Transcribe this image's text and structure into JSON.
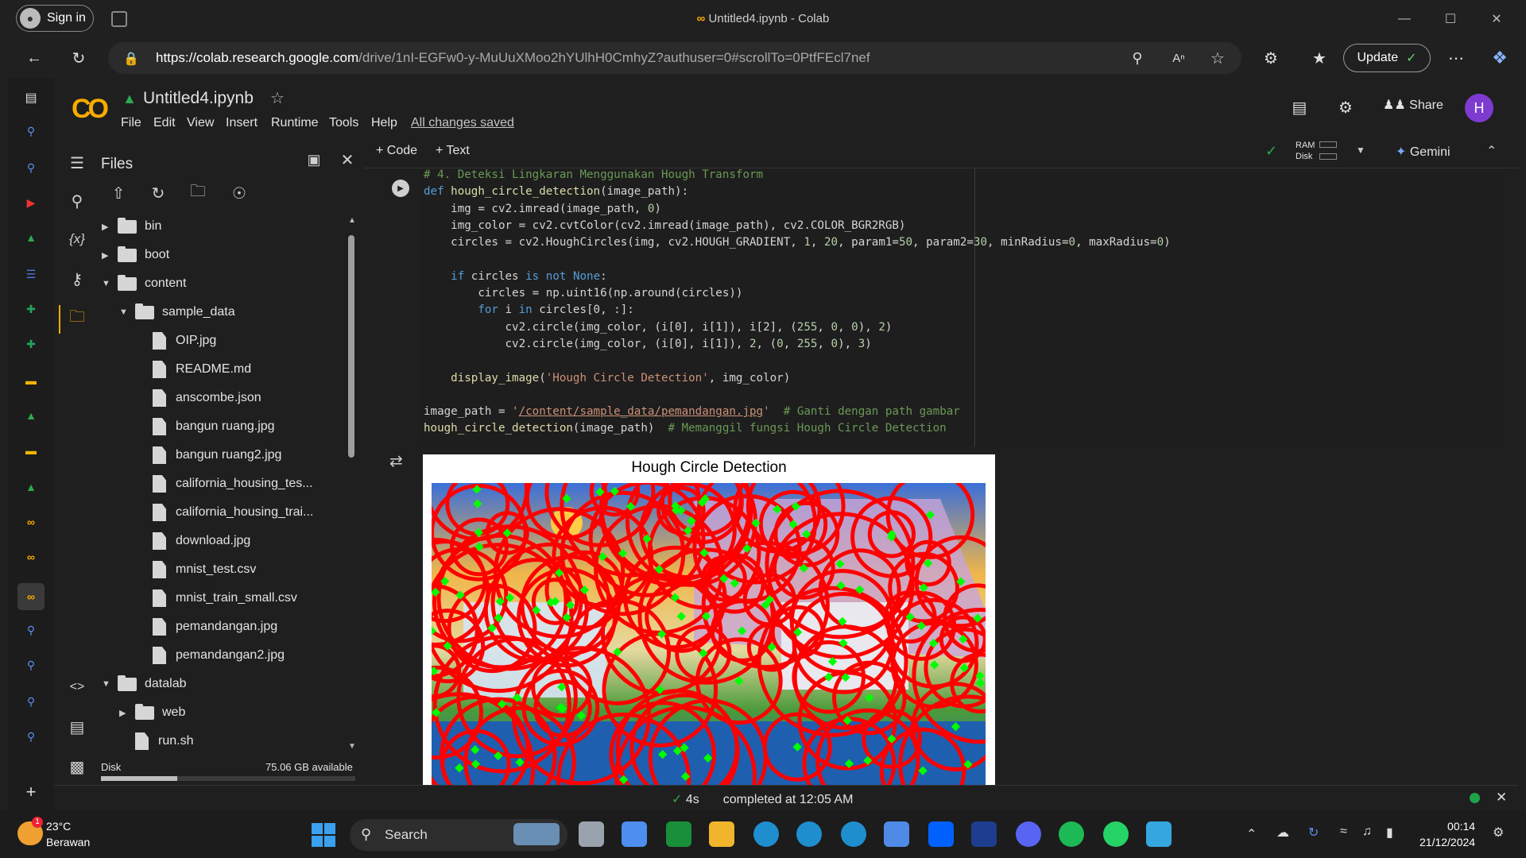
{
  "browser": {
    "sign_in": "Sign in",
    "window_title": "Untitled4.ipynb - Colab",
    "url_host": "https://colab.research.google.com",
    "url_path": "/drive/1nI-EGFw0-y-MuUuXMoo2hYUlhH0CmhyZ?authuser=0#scrollTo=0PtfFEcl7nef",
    "update_label": "Update"
  },
  "colab": {
    "notebook_name": "Untitled4.ipynb",
    "menu": [
      "File",
      "Edit",
      "View",
      "Insert",
      "Runtime",
      "Tools",
      "Help"
    ],
    "saved_status": "All changes saved",
    "share_label": "Share",
    "avatar_letter": "H",
    "add_code": "+ Code",
    "add_text": "+ Text",
    "ram_label": "RAM",
    "disk_label": "Disk",
    "gemini_label": "Gemini"
  },
  "files": {
    "title": "Files",
    "tree": [
      {
        "name": "bin",
        "type": "folder",
        "level": 0,
        "state": "collapsed"
      },
      {
        "name": "boot",
        "type": "folder",
        "level": 0,
        "state": "collapsed"
      },
      {
        "name": "content",
        "type": "folder",
        "level": 0,
        "state": "expanded"
      },
      {
        "name": "sample_data",
        "type": "folder",
        "level": 1,
        "state": "expanded"
      },
      {
        "name": "OIP.jpg",
        "type": "file",
        "level": 2
      },
      {
        "name": "README.md",
        "type": "file",
        "level": 2
      },
      {
        "name": "anscombe.json",
        "type": "file",
        "level": 2
      },
      {
        "name": "bangun ruang.jpg",
        "type": "file",
        "level": 2
      },
      {
        "name": "bangun ruang2.jpg",
        "type": "file",
        "level": 2
      },
      {
        "name": "california_housing_tes...",
        "type": "file",
        "level": 2
      },
      {
        "name": "california_housing_trai...",
        "type": "file",
        "level": 2
      },
      {
        "name": "download.jpg",
        "type": "file",
        "level": 2
      },
      {
        "name": "mnist_test.csv",
        "type": "file",
        "level": 2
      },
      {
        "name": "mnist_train_small.csv",
        "type": "file",
        "level": 2
      },
      {
        "name": "pemandangan.jpg",
        "type": "file",
        "level": 2
      },
      {
        "name": "pemandangan2.jpg",
        "type": "file",
        "level": 2
      },
      {
        "name": "datalab",
        "type": "folder",
        "level": 0,
        "state": "expanded"
      },
      {
        "name": "web",
        "type": "folder",
        "level": 1,
        "state": "collapsed"
      },
      {
        "name": "run.sh",
        "type": "file",
        "level": 1
      }
    ],
    "disk_label": "Disk",
    "disk_available": "75.06 GB available",
    "disk_used_fraction": 0.3
  },
  "cell": {
    "lines": [
      "# 4. Deteksi Lingkaran Menggunakan Hough Transform",
      "def hough_circle_detection(image_path):",
      "    img = cv2.imread(image_path, 0)",
      "    img_color = cv2.cvtColor(cv2.imread(image_path), cv2.COLOR_BGR2RGB)",
      "    circles = cv2.HoughCircles(img, cv2.HOUGH_GRADIENT, 1, 20, param1=50, param2=30, minRadius=0, maxRadius=0)",
      "",
      "    if circles is not None:",
      "        circles = np.uint16(np.around(circles))",
      "        for i in circles[0, :]:",
      "            cv2.circle(img_color, (i[0], i[1]), i[2], (255, 0, 0), 2)",
      "            cv2.circle(img_color, (i[0], i[1]), 2, (0, 255, 0), 3)",
      "",
      "    display_image('Hough Circle Detection', img_color)",
      "",
      "image_path = '/content/sample_data/pemandangan.jpg'  # Ganti dengan path gambar",
      "hough_circle_detection(image_path)  # Memanggil fungsi Hough Circle Detection"
    ],
    "output_title": "Hough Circle Detection"
  },
  "status": {
    "duration": "4s",
    "message": "completed at 12:05 AM"
  },
  "taskbar": {
    "temperature": "23°C",
    "weather": "Berawan",
    "weather_badge": "1",
    "search_placeholder": "Search",
    "time": "00:14",
    "date": "21/12/2024"
  },
  "colors": {
    "colab_orange": "#f9ab00",
    "circle_red": "#ff0000",
    "center_green": "#00ff00",
    "avatar_purple": "#7e3bd0"
  }
}
